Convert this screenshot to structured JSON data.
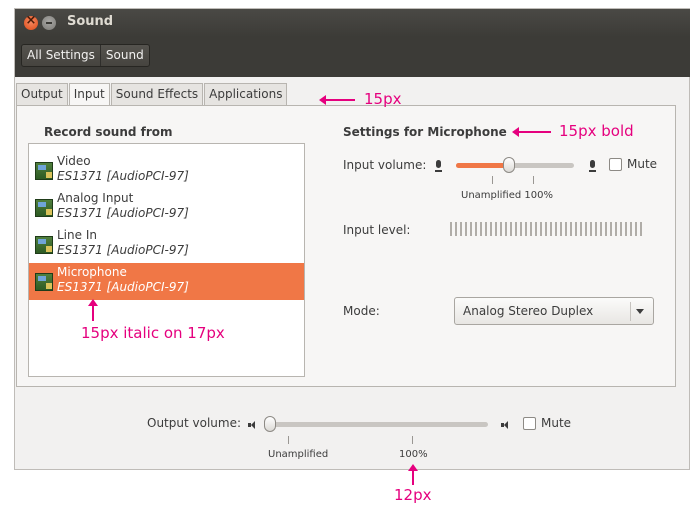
{
  "window": {
    "title": "Sound"
  },
  "breadcrumb": [
    "All Settings",
    "Sound"
  ],
  "tabs": [
    "Output",
    "Input",
    "Sound Effects",
    "Applications"
  ],
  "active_tab": "Input",
  "record": {
    "heading": "Record sound from",
    "devices": [
      {
        "name": "Video",
        "sub": "ES1371 [AudioPCI-97]"
      },
      {
        "name": "Analog Input",
        "sub": "ES1371 [AudioPCI-97]"
      },
      {
        "name": "Line In",
        "sub": "ES1371 [AudioPCI-97]"
      },
      {
        "name": "Microphone",
        "sub": "ES1371 [AudioPCI-97]",
        "selected": true
      }
    ]
  },
  "settings": {
    "heading": "Settings for Microphone",
    "input_volume_label": "Input volume:",
    "input_volume_value": 0.45,
    "unamplified_100": "Unamplified 100%",
    "mute_label": "Mute",
    "input_level_label": "Input level:",
    "mode_label": "Mode:",
    "mode_value": "Analog Stereo Duplex"
  },
  "output": {
    "label": "Output volume:",
    "value": 0.0,
    "mute_label": "Mute",
    "unamplified": "Unamplified",
    "hundred": "100%"
  },
  "annotations": {
    "tabs_font": "15px",
    "heading_font": "15px bold",
    "item_font": "15px italic on 17px",
    "small_font": "12px"
  },
  "colors": {
    "accent": "#f07746",
    "annotation": "#e5007e",
    "titlebar": "#3c3b37"
  }
}
